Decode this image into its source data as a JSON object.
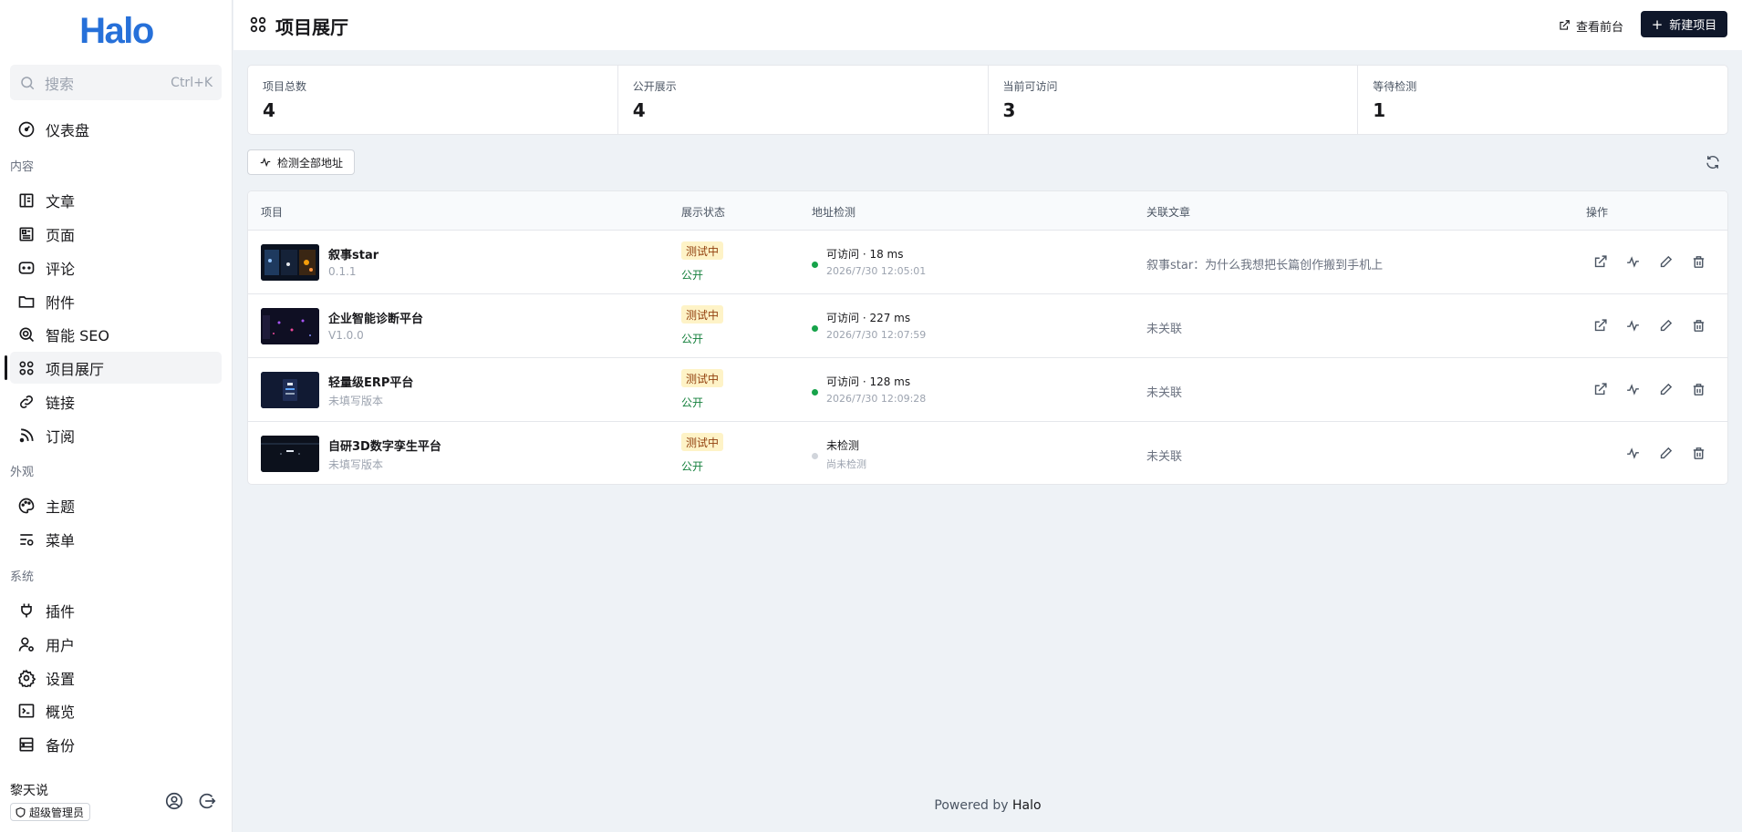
{
  "sidebar": {
    "logo": "Halo",
    "search": {
      "placeholder": "搜索",
      "shortcut": "Ctrl+K"
    },
    "items": [
      {
        "label": "仪表盘",
        "icon": "dashboard-icon"
      },
      {
        "label": "文章",
        "icon": "book-icon"
      },
      {
        "label": "页面",
        "icon": "page-icon"
      },
      {
        "label": "评论",
        "icon": "comment-icon"
      },
      {
        "label": "附件",
        "icon": "folder-icon"
      },
      {
        "label": "智能 SEO",
        "icon": "seo-search-icon"
      },
      {
        "label": "项目展厅",
        "icon": "grid-icon",
        "active": true
      },
      {
        "label": "链接",
        "icon": "link-icon"
      },
      {
        "label": "订阅",
        "icon": "rss-icon"
      },
      {
        "label": "主题",
        "icon": "palette-icon"
      },
      {
        "label": "菜单",
        "icon": "menu-icon"
      },
      {
        "label": "插件",
        "icon": "plug-icon"
      },
      {
        "label": "用户",
        "icon": "user-icon"
      },
      {
        "label": "设置",
        "icon": "gear-icon"
      },
      {
        "label": "概览",
        "icon": "terminal-icon"
      },
      {
        "label": "备份",
        "icon": "backup-icon"
      }
    ],
    "groups": {
      "content": "内容",
      "appearance": "外观",
      "system": "系统"
    },
    "user": {
      "name": "黎天说",
      "role": "超级管理员"
    }
  },
  "header": {
    "title": "项目展厅",
    "view_front": "查看前台",
    "new_project": "新建项目"
  },
  "stats": [
    {
      "label": "项目总数",
      "value": "4"
    },
    {
      "label": "公开展示",
      "value": "4"
    },
    {
      "label": "当前可访问",
      "value": "3"
    },
    {
      "label": "等待检测",
      "value": "1"
    }
  ],
  "toolbar": {
    "check_all": "检测全部地址"
  },
  "table": {
    "columns": {
      "project": "项目",
      "status": "展示状态",
      "check": "地址检测",
      "article": "关联文章",
      "actions": "操作"
    },
    "rows": [
      {
        "name": "叙事star",
        "version": "0.1.1",
        "status": "测试中",
        "visibility": "公开",
        "check": "可访问 · 18 ms",
        "check_time": "2026/7/30 12:05:01",
        "article": "叙事star：为什么我想把长篇创作搬到手机上",
        "ok": true
      },
      {
        "name": "企业智能诊断平台",
        "version": "V1.0.0",
        "status": "测试中",
        "visibility": "公开",
        "check": "可访问 · 227 ms",
        "check_time": "2026/7/30 12:07:59",
        "article": "未关联",
        "ok": true
      },
      {
        "name": "轻量级ERP平台",
        "version": "未填写版本",
        "status": "测试中",
        "visibility": "公开",
        "check": "可访问 · 128 ms",
        "check_time": "2026/7/30 12:09:28",
        "article": "未关联",
        "ok": true
      },
      {
        "name": "自研3D数字孪生平台",
        "version": "未填写版本",
        "status": "测试中",
        "visibility": "公开",
        "check": "未检测",
        "check_time": "尚未检测",
        "article": "未关联",
        "ok": false
      }
    ]
  },
  "footer": {
    "prefix": "Powered by ",
    "brand": "Halo"
  },
  "colors": {
    "accent": "#2670d9",
    "primary": "#0f172a",
    "ok": "#16a34a",
    "pending": "#d1d5db",
    "badge_bg": "#fef3c7"
  }
}
